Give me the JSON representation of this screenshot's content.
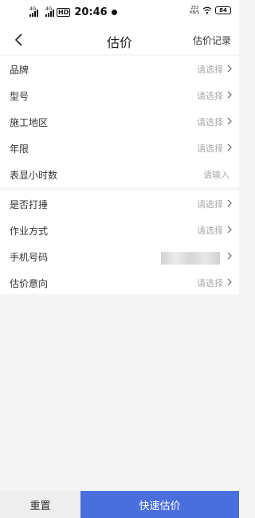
{
  "status_bar": {
    "network_1": "4G",
    "network_2": "4G",
    "hd_badge": "HD",
    "time": "20:46",
    "speed_value": "253",
    "speed_unit": "KB/S",
    "battery": "84"
  },
  "header": {
    "title": "估价",
    "history_link": "估价记录"
  },
  "form_group_1": [
    {
      "label": "品牌",
      "value": "请选择"
    },
    {
      "label": "型号",
      "value": "请选择"
    },
    {
      "label": "施工地区",
      "value": "请选择"
    },
    {
      "label": "年限",
      "value": "请选择"
    },
    {
      "label": "表显小时数",
      "placeholder": "请输入"
    }
  ],
  "form_group_2": [
    {
      "label": "是否打捶",
      "value": "请选择"
    },
    {
      "label": "作业方式",
      "value": "请选择"
    },
    {
      "label": "手机号码"
    },
    {
      "label": "估价意向",
      "value": "请选择"
    }
  ],
  "footer": {
    "reset_label": "重置",
    "submit_label": "快速估价"
  },
  "colors": {
    "accent": "#4a6fdc",
    "placeholder": "#a9a9a9",
    "background": "#f5f5f5"
  }
}
